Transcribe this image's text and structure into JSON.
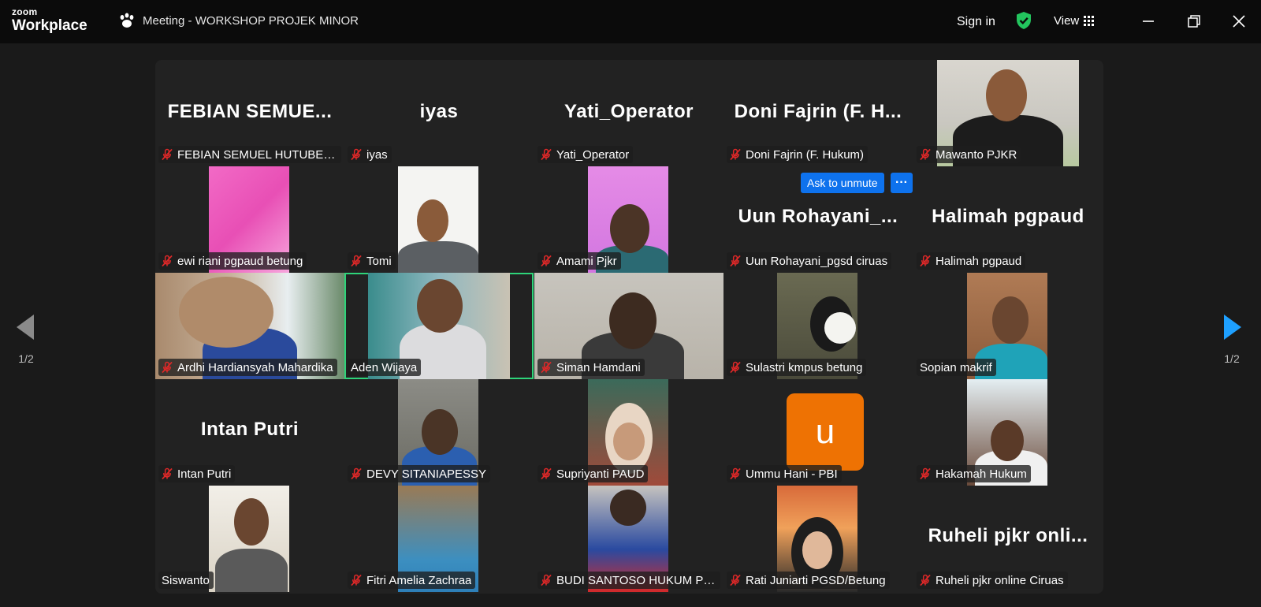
{
  "app": {
    "logo_line1": "zoom",
    "logo_line2": "Workplace",
    "window_title": "Meeting - WORKSHOP PROJEK MINOR"
  },
  "header": {
    "signin": "Sign in",
    "view": "View"
  },
  "controls": {
    "ask_to_unmute": "Ask to unmute",
    "more": "···"
  },
  "pager": {
    "left": "1/2",
    "right": "1/2"
  },
  "colors": {
    "accent": "#0e72ed",
    "active_speaker": "#2ed47a",
    "muted": "#e02828",
    "avatar": "#ee7203",
    "shield": "#23c55e"
  },
  "tiles": [
    {
      "name": "FEBIAN SEMUEL HUTUBESSY",
      "display": "FEBIAN SEMUE...",
      "type": "name"
    },
    {
      "name": "iyas",
      "display": "iyas",
      "type": "name"
    },
    {
      "name": "Yati_Operator",
      "display": "Yati_Operator",
      "type": "name"
    },
    {
      "name": "Doni Fajrin (F. Hukum)",
      "display": "Doni Fajrin (F. H...",
      "type": "name"
    },
    {
      "name": "Mawanto PJKR",
      "type": "video"
    },
    {
      "name": "ewi riani pgpaud  betung",
      "type": "video"
    },
    {
      "name": "Tomi",
      "type": "video"
    },
    {
      "name": "Amami Pjkr",
      "type": "video"
    },
    {
      "name": "Uun Rohayani_pgsd ciruas",
      "display": "Uun Rohayani_...",
      "type": "name"
    },
    {
      "name": "Halimah pgpaud",
      "display": "Halimah pgpaud",
      "type": "name"
    },
    {
      "name": "Ardhi Hardiansyah Mahardika",
      "type": "video"
    },
    {
      "name": "Aden Wijaya",
      "type": "video"
    },
    {
      "name": "Siman Hamdani",
      "type": "video"
    },
    {
      "name": "Sulastri kmpus betung",
      "type": "video"
    },
    {
      "name": "Sopian makrif",
      "type": "video"
    },
    {
      "name": "Intan Putri",
      "display": "Intan Putri",
      "type": "name"
    },
    {
      "name": "DEVY SITANIAPESSY",
      "type": "video"
    },
    {
      "name": "Supriyanti PAUD",
      "type": "video"
    },
    {
      "name": "Ummu Hani - PBI",
      "avatar_letter": "u",
      "type": "avatar"
    },
    {
      "name": "Hakamah Hukum",
      "type": "video"
    },
    {
      "name": "Siswanto",
      "type": "video"
    },
    {
      "name": "Fitri Amelia Zachraa",
      "type": "video"
    },
    {
      "name": "BUDI SANTOSO HUKUM Pen...",
      "type": "video"
    },
    {
      "name": "Rati Juniarti PGSD/Betung",
      "type": "video"
    },
    {
      "name": "Ruheli pjkr online Ciruas",
      "display": "Ruheli pjkr onli...",
      "type": "name"
    }
  ]
}
